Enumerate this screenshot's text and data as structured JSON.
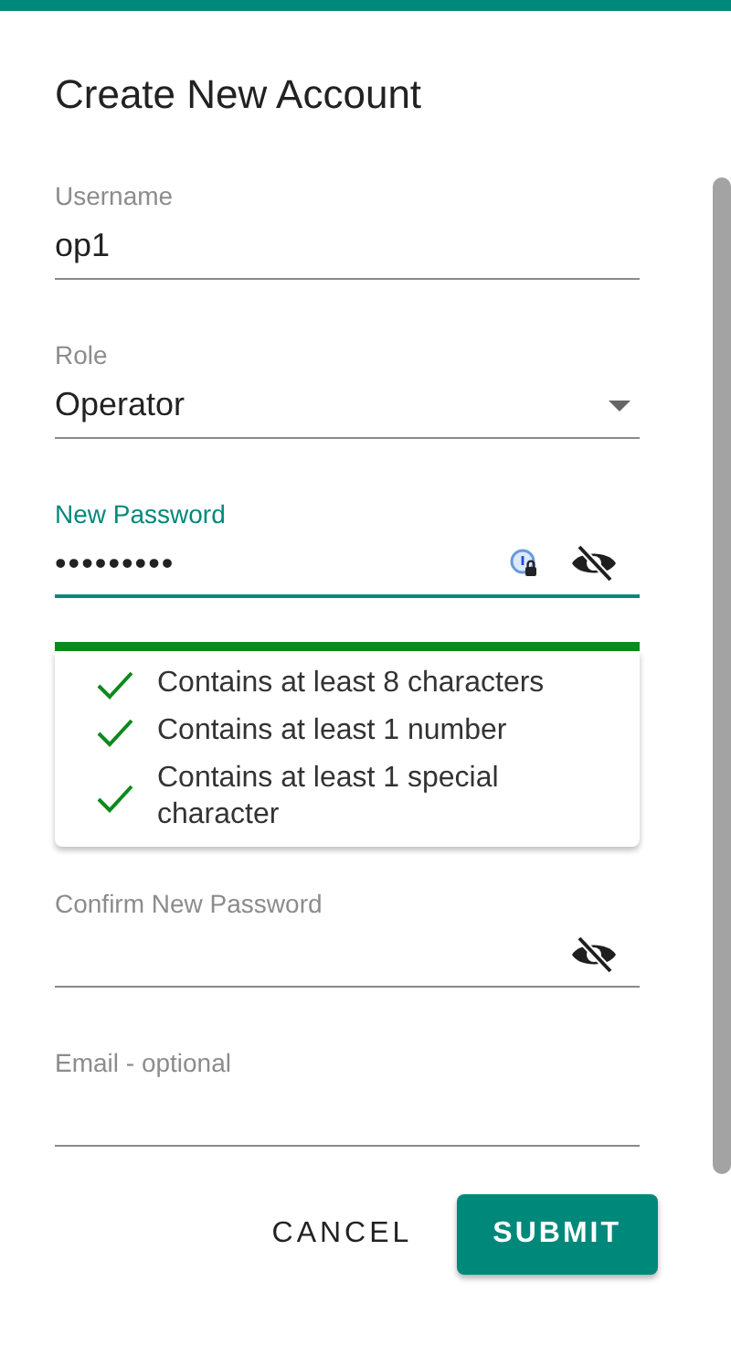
{
  "dialog": {
    "title": "Create New Account"
  },
  "fields": [
    {
      "kind": "text",
      "label": "Username",
      "value": "op1",
      "focused": false
    },
    {
      "kind": "select",
      "label": "Role",
      "value": "Operator",
      "focused": false
    },
    {
      "kind": "password",
      "label": "New Password",
      "value": "•••••••••",
      "focused": true,
      "password_manager": true
    },
    {
      "kind": "strength",
      "level": 1,
      "requirements": [
        {
          "text": "Contains at least 8 characters",
          "met": true
        },
        {
          "text": "Contains at least 1 number",
          "met": true
        },
        {
          "text": "Contains at least 1 special character",
          "met": true
        }
      ]
    },
    {
      "kind": "password",
      "label": "Confirm New Password",
      "focused": false,
      "password_manager": false
    },
    {
      "kind": "text",
      "label": "Email - optional",
      "focused": false
    }
  ],
  "buttons": [
    {
      "label": "CANCEL",
      "kind": "text"
    },
    {
      "label": "SUBMIT",
      "kind": "primary"
    }
  ]
}
